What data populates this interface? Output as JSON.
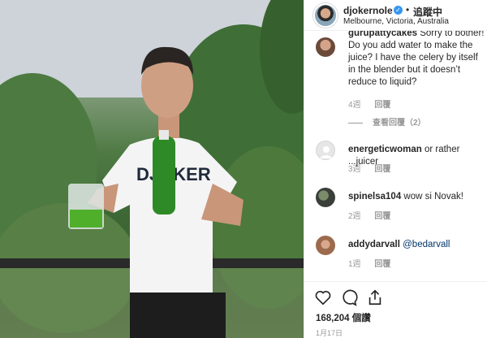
{
  "header": {
    "username": "djokernole",
    "separator": "•",
    "follow_label": "追蹤中",
    "location": "Melbourne, Victoria, Australia",
    "verified_icon": "verified-badge-icon"
  },
  "photo": {
    "shirt_text": "DJOKER"
  },
  "comments": [
    {
      "user": "gurupattycakes",
      "text": "Sorry to bother! Do you add water to make the juice? I have the celery by itself in the blender but it doesn’t reduce to liquid?",
      "time": "4週",
      "reply": "回覆"
    },
    {
      "user": "energeticwoman",
      "text": "or rather ...juicer",
      "time": "3週",
      "reply": "回覆"
    },
    {
      "user": "spinelsa104",
      "text": "wow si Novak!",
      "time": "2週",
      "reply": "回覆"
    },
    {
      "user": "addydarvall",
      "text": "@bedarvall",
      "time": "1週",
      "reply": "回覆"
    }
  ],
  "view_replies": "查看回覆（2）",
  "actions": {
    "likes": "168,204 個讚",
    "date": "1月17日",
    "icons": [
      "heart-icon",
      "comment-icon",
      "share-icon"
    ]
  },
  "colors": {
    "link": "#003569",
    "verified": "#3897f0",
    "meta": "#999999"
  }
}
